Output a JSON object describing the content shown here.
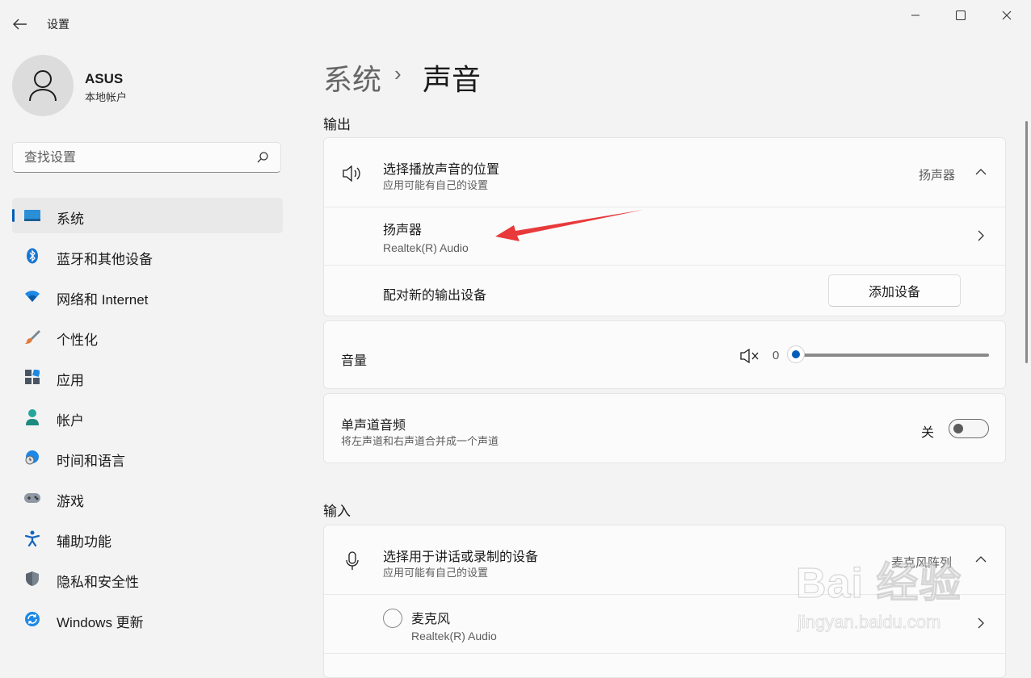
{
  "window": {
    "title": "设置",
    "minimize": "minimize",
    "maximize": "maximize",
    "close": "close"
  },
  "user": {
    "name": "ASUS",
    "account_type": "本地帐户"
  },
  "search": {
    "placeholder": "查找设置"
  },
  "nav": {
    "items": [
      {
        "label": "系统",
        "icon": "system-icon",
        "active": true
      },
      {
        "label": "蓝牙和其他设备",
        "icon": "bluetooth-icon"
      },
      {
        "label": "网络和 Internet",
        "icon": "wifi-icon"
      },
      {
        "label": "个性化",
        "icon": "brush-icon"
      },
      {
        "label": "应用",
        "icon": "apps-icon"
      },
      {
        "label": "帐户",
        "icon": "account-icon"
      },
      {
        "label": "时间和语言",
        "icon": "globe-clock-icon"
      },
      {
        "label": "游戏",
        "icon": "gamepad-icon"
      },
      {
        "label": "辅助功能",
        "icon": "accessibility-icon"
      },
      {
        "label": "隐私和安全性",
        "icon": "shield-icon"
      },
      {
        "label": "Windows 更新",
        "icon": "update-icon"
      }
    ]
  },
  "breadcrumb": {
    "parent": "系统",
    "separator": "›",
    "current": "声音"
  },
  "output": {
    "section_title": "输出",
    "choose_title": "选择播放声音的位置",
    "choose_subtitle": "应用可能有自己的设置",
    "choose_value": "扬声器",
    "device_name": "扬声器",
    "device_sub": "Realtek(R) Audio",
    "pair_label": "配对新的输出设备",
    "add_button": "添加设备",
    "volume_label": "音量",
    "volume_value": "0",
    "mono_title": "单声道音频",
    "mono_subtitle": "将左声道和右声道合并成一个声道",
    "mono_state": "关"
  },
  "input": {
    "section_title": "输入",
    "choose_title": "选择用于讲话或录制的设备",
    "choose_subtitle": "应用可能有自己的设置",
    "choose_value": "麦克风阵列",
    "device_name": "麦克风",
    "device_sub": "Realtek(R) Audio"
  },
  "watermark": {
    "brand": "Bai 经验",
    "url": "jingyan.baidu.com"
  },
  "colors": {
    "accent": "#005fb8",
    "annotation_arrow": "#e8393b"
  }
}
